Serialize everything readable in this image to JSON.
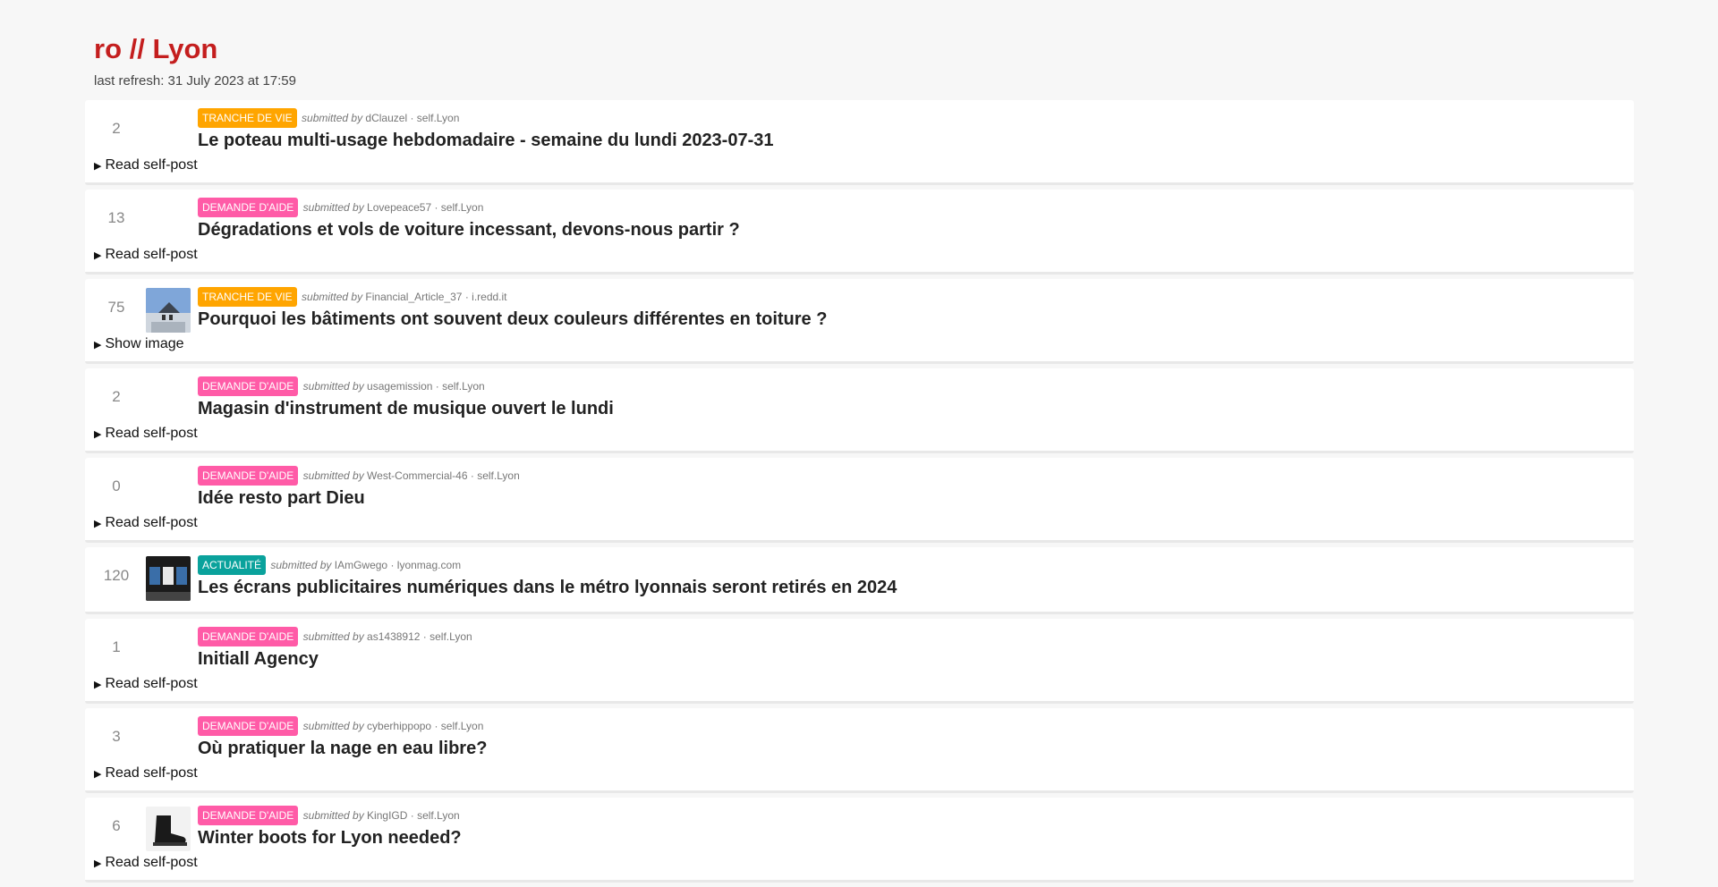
{
  "page": {
    "title": "ro // Lyon",
    "refresh": "last refresh: 31 July 2023 at 17:59"
  },
  "labels": {
    "submitted_by": "submitted by"
  },
  "posts": [
    {
      "score": "2",
      "flair": "TRANCHE DE VIE",
      "flair_color": "#ffa500",
      "author": "dClauzel",
      "domain": "self.Lyon",
      "title": "Le poteau multi-usage hebdomadaire - semaine du lundi 2023-07-31",
      "toggle": "Read self-post"
    },
    {
      "score": "13",
      "flair": "DEMANDE D'AIDE",
      "flair_color": "#ff5ba7",
      "author": "Lovepeace57",
      "domain": "self.Lyon",
      "title": "Dégradations et vols de voiture incessant, devons-nous partir ?",
      "toggle": "Read self-post"
    },
    {
      "score": "75",
      "flair": "TRANCHE DE VIE",
      "flair_color": "#ffa500",
      "author": "Financial_Article_37",
      "domain": "i.redd.it",
      "title": "Pourquoi les bâtiments ont souvent deux couleurs différentes en toiture ?",
      "toggle": "Show image",
      "thumb": "building-photo"
    },
    {
      "score": "2",
      "flair": "DEMANDE D'AIDE",
      "flair_color": "#ff5ba7",
      "author": "usagemission",
      "domain": "self.Lyon",
      "title": "Magasin d'instrument de musique ouvert le lundi",
      "toggle": "Read self-post"
    },
    {
      "score": "0",
      "flair": "DEMANDE D'AIDE",
      "flair_color": "#ff5ba7",
      "author": "West-Commercial-46",
      "domain": "self.Lyon",
      "title": "Idée resto part Dieu",
      "toggle": "Read self-post"
    },
    {
      "score": "120",
      "flair": "ACTUALITÉ",
      "flair_color": "#0aa29c",
      "author": "IAmGwego",
      "domain": "lyonmag.com",
      "title": "Les écrans publicitaires numériques dans le métro lyonnais seront retirés en 2024",
      "thumb": "metro-screens-photo"
    },
    {
      "score": "1",
      "flair": "DEMANDE D'AIDE",
      "flair_color": "#ff5ba7",
      "author": "as1438912",
      "domain": "self.Lyon",
      "title": "Initiall Agency",
      "toggle": "Read self-post"
    },
    {
      "score": "3",
      "flair": "DEMANDE D'AIDE",
      "flair_color": "#ff5ba7",
      "author": "cyberhippopo",
      "domain": "self.Lyon",
      "title": "Où pratiquer la nage en eau libre?",
      "toggle": "Read self-post"
    },
    {
      "score": "6",
      "flair": "DEMANDE D'AIDE",
      "flair_color": "#ff5ba7",
      "author": "KingIGD",
      "domain": "self.Lyon",
      "title": "Winter boots for Lyon needed?",
      "toggle": "Read self-post",
      "thumb": "boot-photo"
    }
  ]
}
